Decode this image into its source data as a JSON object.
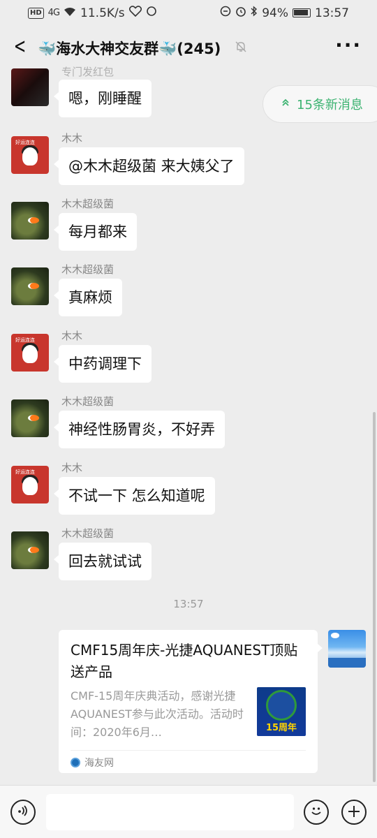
{
  "status_bar": {
    "network_badge": "HD",
    "signal": "4G",
    "speed": "11.5K/s",
    "battery": "94%",
    "time": "13:57"
  },
  "header": {
    "title": "🐳海水大神交友群🐳(245)",
    "more": "···",
    "back": "<"
  },
  "new_messages_pill": {
    "label": "15条新消息"
  },
  "messages": [
    {
      "sender": "专门发红包",
      "avatar": "dark",
      "text": "嗯，刚睡醒"
    },
    {
      "sender": "木木",
      "avatar": "muu",
      "text": "@木木超级菌  来大姨父了"
    },
    {
      "sender": "木木超级菌",
      "avatar": "fish",
      "text": "每月都来"
    },
    {
      "sender": "木木超级菌",
      "avatar": "fish",
      "text": "真麻烦"
    },
    {
      "sender": "木木",
      "avatar": "muu",
      "text": "中药调理下"
    },
    {
      "sender": "木木超级菌",
      "avatar": "fish",
      "text": "神经性肠胃炎，不好弄"
    },
    {
      "sender": "木木",
      "avatar": "muu",
      "text": "不试一下 怎么知道呢"
    },
    {
      "sender": "木木超级菌",
      "avatar": "fish",
      "text": "回去就试试"
    }
  ],
  "timestamp": "13:57",
  "link_card": {
    "title": "CMF15周年庆-光捷AQUANEST顶贴送产品",
    "description": "CMF-15周年庆典活动，感谢光捷AQUANEST参与此次活动。活动时间：2020年6月…",
    "thumb_text": "15周年",
    "source": "海友网"
  },
  "input_bar": {
    "placeholder": ""
  },
  "colors": {
    "accent_green": "#3cb371",
    "background": "#ededed",
    "bubble": "#ffffff"
  }
}
